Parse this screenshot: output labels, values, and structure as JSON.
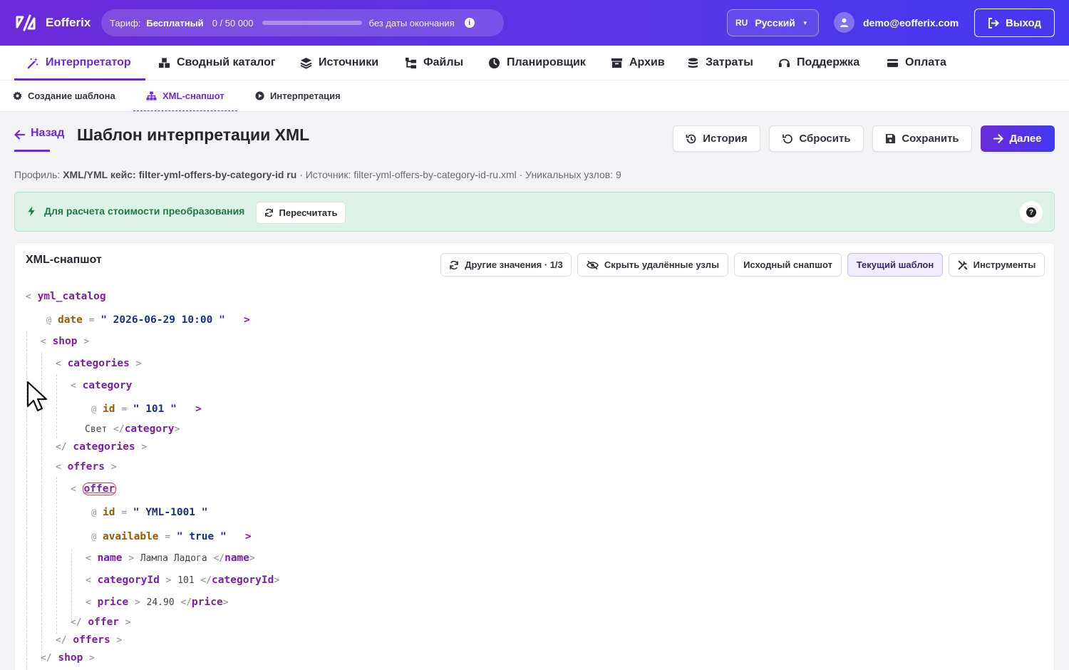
{
  "app": {
    "name": "Eofferix",
    "plan": {
      "label": "Тариф:",
      "value": "Бесплатный",
      "usage": "0 / 50 000",
      "progress_fraction": 0.0,
      "expiry": "без даты окончания"
    },
    "language": {
      "code": "RU",
      "label": "Русский"
    },
    "user_email": "demo@eofferix.com",
    "logout_label": "Выход"
  },
  "main_nav": [
    {
      "label": "Интерпретатор",
      "icon": "magic-wand-icon",
      "active": true
    },
    {
      "label": "Сводный каталог",
      "icon": "boxes-icon"
    },
    {
      "label": "Источники",
      "icon": "layers-icon"
    },
    {
      "label": "Файлы",
      "icon": "file-tree-icon"
    },
    {
      "label": "Планировщик",
      "icon": "clock-icon"
    },
    {
      "label": "Архив",
      "icon": "archive-icon"
    },
    {
      "label": "Затраты",
      "icon": "coins-icon"
    },
    {
      "label": "Поддержка",
      "icon": "headset-icon"
    },
    {
      "label": "Оплата",
      "icon": "credit-card-icon"
    }
  ],
  "sub_nav": [
    {
      "label": "Создание шаблона",
      "icon": "gear-icon"
    },
    {
      "label": "XML-снапшот",
      "icon": "sitemap-icon",
      "active": true
    },
    {
      "label": "Интерпретация",
      "icon": "play-circle-icon"
    }
  ],
  "page": {
    "back_label": "Назад",
    "title": "Шаблон интерпретации XML",
    "buttons": {
      "history": "История",
      "reset": "Сбросить",
      "save": "Сохранить",
      "next": "Далее"
    },
    "meta": {
      "profile_label": "Профиль:",
      "profile_value": "XML/YML кейс: filter-yml-offers-by-category-id ru",
      "source": "· Источник: filter-yml-offers-by-category-id-ru.xml",
      "unique_nodes": "· Уникальных узлов: 9"
    }
  },
  "alert": {
    "message": "Для расчета стоимости преобразования",
    "recalc_label": "Пересчитать"
  },
  "snapshot": {
    "title": "XML-снапшот",
    "toolbar": {
      "other_values": "Другие значения · 1/3",
      "hide_deleted": "Скрыть удалённые узлы",
      "original": "Исходный снапшот",
      "current": "Текущий шаблон",
      "tools": "Инструменты"
    },
    "tree": {
      "yml_catalog": "yml_catalog",
      "date_attr": "date",
      "date_value": "2026-06-29 10:00",
      "shop": "shop",
      "categories": "categories",
      "category": "category",
      "id_attr": "id",
      "category_id_value": "101",
      "category_text": "Свет",
      "offers": "offers",
      "offer": "offer",
      "offer_id_value": "YML-1001",
      "available_attr": "available",
      "available_value": "true",
      "name": "name",
      "name_text": "Лампа Ладога",
      "categoryId": "categoryId",
      "categoryId_text": "101",
      "price": "price",
      "price_text": "24.90"
    }
  },
  "colors": {
    "brand": "#6b2bd9",
    "brand_end": "#4338f0",
    "alert_bg": "#dcf2e6",
    "alert_text": "#1f7a45",
    "xml_tag": "#7a1fa2",
    "xml_attr": "#9c5a00",
    "xml_value": "#1c2f7a"
  }
}
